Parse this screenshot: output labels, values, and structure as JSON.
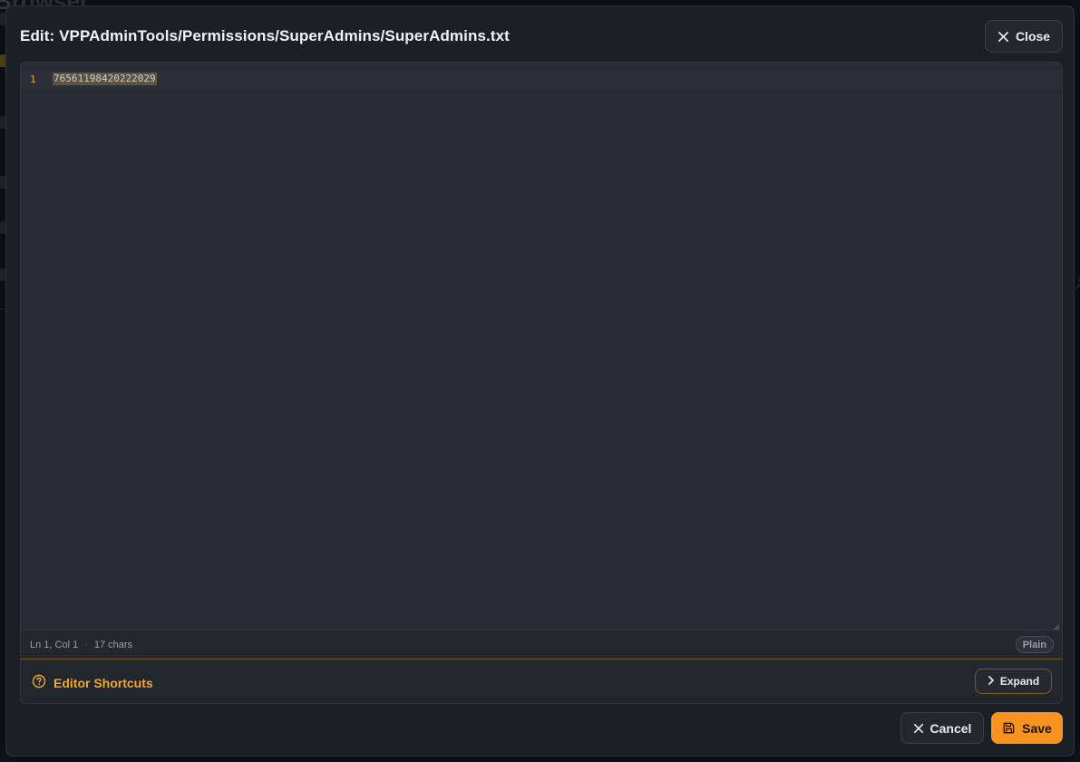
{
  "background": {
    "title": "Browser"
  },
  "modal": {
    "title": "Edit: VPPAdminTools/Permissions/SuperAdmins/SuperAdmins.txt",
    "close_label": "Close"
  },
  "editor": {
    "lines": [
      {
        "number": "1",
        "text": "76561198420222029"
      }
    ],
    "status": {
      "position": "Ln 1, Col 1",
      "separator": "·",
      "chars": "17 chars",
      "mode": "Plain"
    },
    "shortcuts": {
      "title": "Editor Shortcuts",
      "expand_label": "Expand"
    }
  },
  "footer": {
    "cancel_label": "Cancel",
    "save_label": "Save"
  },
  "colors": {
    "accent": "#f7931e",
    "shortcut_title": "#f5a623",
    "line_number": "#e6a23c"
  }
}
